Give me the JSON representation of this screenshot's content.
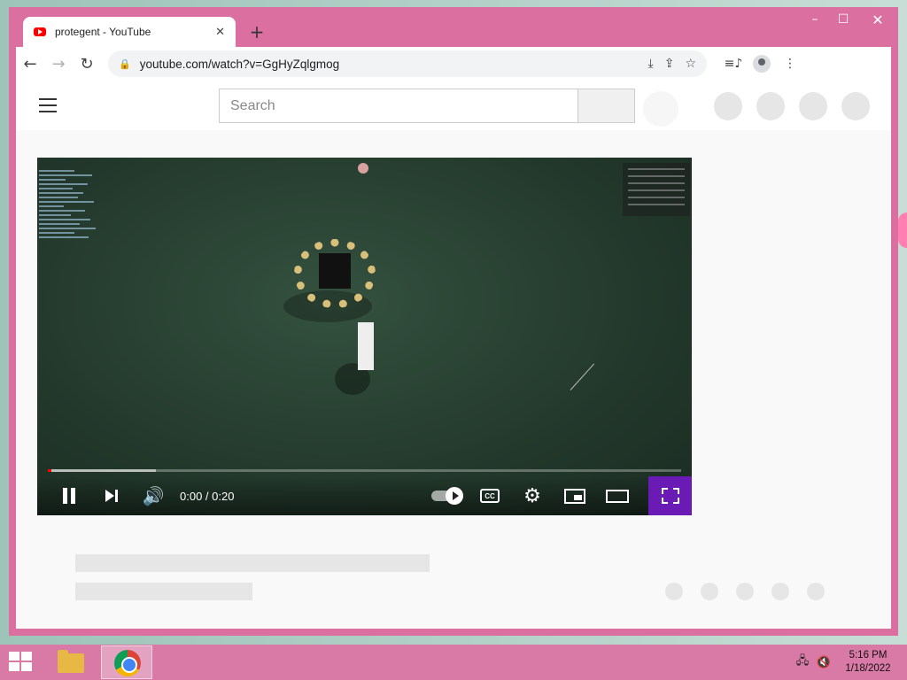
{
  "browser": {
    "tab": {
      "title": "protegent - YouTube",
      "close_glyph": "✕",
      "icon": "youtube-favicon"
    },
    "new_tab_glyph": "+",
    "window_controls": {
      "minimize": "–",
      "maximize": "☐",
      "close": "✕"
    },
    "toolbar": {
      "back_glyph": "←",
      "forward_glyph": "→",
      "reload_glyph": "↻",
      "lock_glyph": "🔒",
      "url": "youtube.com/watch?v=GgHyZqlgmog",
      "install_glyph": "⤓",
      "share_glyph": "⇪",
      "bookmark_glyph": "☆",
      "media_glyph": "≡♪",
      "menu_glyph": "⋮"
    }
  },
  "youtube": {
    "search": {
      "placeholder": "Search"
    },
    "player": {
      "time": "0:00 / 0:20",
      "progress_played": 0.003,
      "progress_buffered": 0.17,
      "volume_glyph": "🔊",
      "settings_glyph": "⚙",
      "cc_label": "CC",
      "accent_color": "#ff0000",
      "fullscreen_bg": "#6a1bb5"
    }
  },
  "taskbar": {
    "clock_time": "5:16 PM",
    "clock_date": "1/18/2022",
    "network_glyph": "🖧",
    "volume_muted_glyph": "🔇"
  },
  "colors": {
    "window_frame": "#db6fa0",
    "taskbar": "#d97aa6"
  }
}
